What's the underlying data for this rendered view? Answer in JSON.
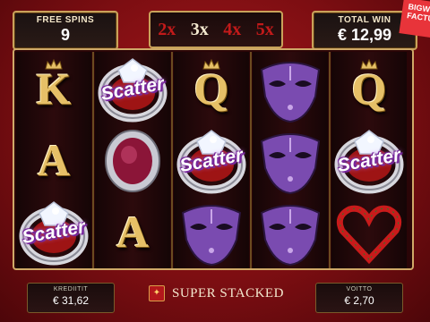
{
  "free_spins": {
    "label": "FREE SPINS",
    "value": "9"
  },
  "multipliers": [
    {
      "label": "2x",
      "active": false
    },
    {
      "label": "3x",
      "active": true
    },
    {
      "label": "4x",
      "active": false
    },
    {
      "label": "5x",
      "active": false
    }
  ],
  "total_win": {
    "label": "TOTAL WIN",
    "value": "€ 12,99"
  },
  "corner_badge": "BIGWI FACTUR",
  "reels": [
    [
      "K",
      "A",
      "scatter"
    ],
    [
      "scatter",
      "ruby",
      "A"
    ],
    [
      "Q",
      "scatter",
      "mask"
    ],
    [
      "mask",
      "mask",
      "mask"
    ],
    [
      "Q",
      "scatter",
      "heart"
    ]
  ],
  "scatter_text": "Scatter",
  "credits": {
    "label": "KREDIITIT",
    "value": "€ 31,62"
  },
  "win": {
    "label": "VOITTO",
    "value": "€ 2,70"
  },
  "super_stacked": "SUPER STACKED",
  "colors": {
    "gold": "#e6c067",
    "frame": "#cfa968",
    "background": "#7d0e12",
    "multiplier_inactive": "#c21a1a",
    "mask": "#7a4bb0"
  }
}
